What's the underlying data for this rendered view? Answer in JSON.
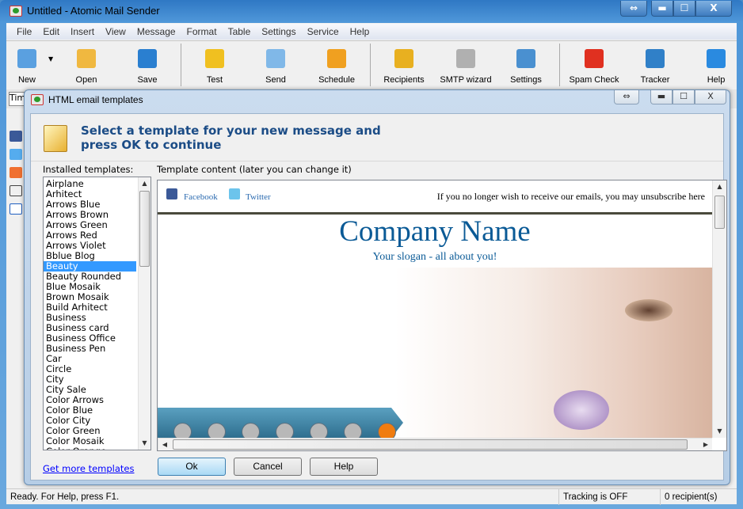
{
  "window": {
    "title": "Untitled - Atomic Mail Sender",
    "buttons": {
      "resize": "⇔",
      "minimize": "▬",
      "maximize": "☐",
      "close": "X"
    }
  },
  "menu": [
    "File",
    "Edit",
    "Insert",
    "View",
    "Message",
    "Format",
    "Table",
    "Settings",
    "Service",
    "Help"
  ],
  "toolbar": [
    {
      "label": "New",
      "icon": "new-message-icon",
      "color": "#5aa0e0"
    },
    {
      "label": "Open",
      "icon": "open-folder-icon",
      "color": "#f0b840"
    },
    {
      "label": "Save",
      "icon": "save-disk-icon",
      "color": "#2a7fd0"
    },
    {
      "label": "Test",
      "icon": "test-send-icon",
      "color": "#f0c020"
    },
    {
      "label": "Send",
      "icon": "send-mail-icon",
      "color": "#80b8e8"
    },
    {
      "label": "Schedule",
      "icon": "schedule-clock-icon",
      "color": "#f0a020"
    },
    {
      "label": "Recipients",
      "icon": "recipients-gear-icon",
      "color": "#e8b020"
    },
    {
      "label": "SMTP wizard",
      "icon": "smtp-server-icon",
      "color": "#b0b0b0"
    },
    {
      "label": "Settings",
      "icon": "settings-gear-icon",
      "color": "#4a90d0"
    },
    {
      "label": "Spam Check",
      "icon": "spam-check-icon",
      "color": "#e03020"
    },
    {
      "label": "Tracker",
      "icon": "tracker-globe-icon",
      "color": "#3080c8"
    },
    {
      "label": "Help",
      "icon": "help-question-icon",
      "color": "#2a8ae0"
    }
  ],
  "format_font": "Tim",
  "dialog": {
    "title": "HTML email templates",
    "header": "Select a template for your new message and press OK to continue",
    "installed_label": "Installed templates:",
    "content_label": "Template content (later you can change it)",
    "templates": [
      "Airplane",
      "Arhitect",
      "Arrows Blue",
      "Arrows Brown",
      "Arrows Green",
      "Arrows Red",
      "Arrows Violet",
      "Bblue Blog",
      "Beauty",
      "Beauty Rounded",
      "Blue Mosaik",
      "Brown Mosaik",
      "Build Arhitect",
      "Business",
      "Business card",
      "Business Office",
      "Business Pen",
      "Car",
      "Circle",
      "City",
      "City Sale",
      "Color Arrows",
      "Color Blue",
      "Color City",
      "Color Green",
      "Color Mosaik",
      "Color Orange"
    ],
    "selected": "Beauty",
    "preview": {
      "facebook": "Facebook",
      "twitter": "Twitter",
      "unsubscribe": "If you no longer wish to receive our emails, you may unsubscribe here",
      "company": "Company Name",
      "slogan": "Your slogan - all about you!"
    },
    "get_more": "Get more templates",
    "ok": "Ok",
    "cancel": "Cancel",
    "help": "Help"
  },
  "status": {
    "message": "Ready. For Help, press F1.",
    "tracking": "Tracking is OFF",
    "recipients": "0 recipient(s)"
  }
}
